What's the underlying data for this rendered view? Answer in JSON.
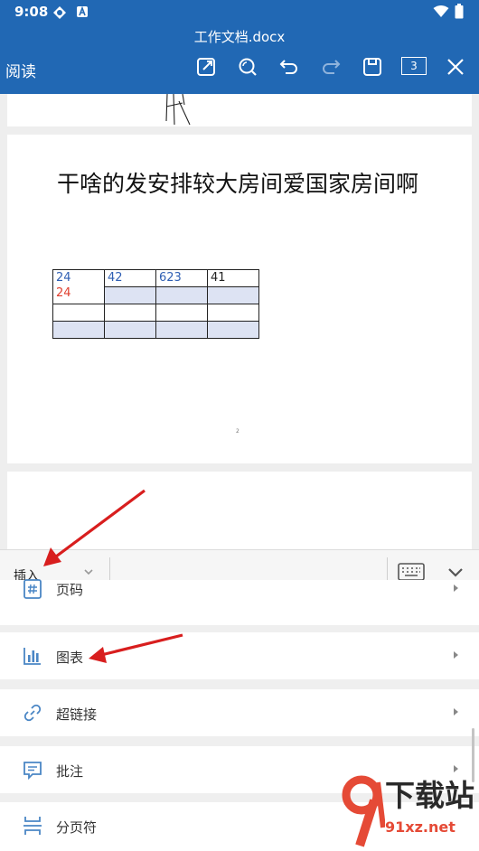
{
  "status_bar": {
    "time": "9:08"
  },
  "app_bar": {
    "document_title": "工作文档.docx",
    "mode_label": "阅读",
    "page_count": "3"
  },
  "document": {
    "heading": "干啥的发安排较大房间爱国家房间啊",
    "table": {
      "rows": [
        [
          {
            "text": "24",
            "text2": "24",
            "color": "#2f5fb3",
            "color2": "#e04030"
          },
          {
            "text": "42",
            "color": "#2f5fb3"
          },
          {
            "text": "623",
            "color": "#2f5fb3"
          },
          {
            "text": "41",
            "color": "#222222"
          }
        ],
        [
          {
            "text": ""
          },
          {
            "text": ""
          },
          {
            "text": ""
          },
          {
            "text": ""
          }
        ],
        [
          {
            "text": ""
          },
          {
            "text": ""
          },
          {
            "text": ""
          },
          {
            "text": ""
          }
        ]
      ],
      "shaded_color": "#dde3f3"
    },
    "page_number": "2"
  },
  "toolbar": {
    "tab_label": "插入"
  },
  "insert_menu": {
    "items": [
      {
        "label": "页码",
        "icon": "page-number-icon"
      },
      {
        "label": "图表",
        "icon": "chart-icon"
      },
      {
        "label": "超链接",
        "icon": "link-icon"
      },
      {
        "label": "批注",
        "icon": "comment-icon"
      },
      {
        "label": "分页符",
        "icon": "page-break-icon"
      }
    ]
  },
  "watermark": {
    "brand": "下载站",
    "url": "91xz.net"
  },
  "colors": {
    "app_bar": "#2168b4",
    "annotation_arrow": "#d81e1e",
    "icon_blue": "#4a86c5"
  }
}
